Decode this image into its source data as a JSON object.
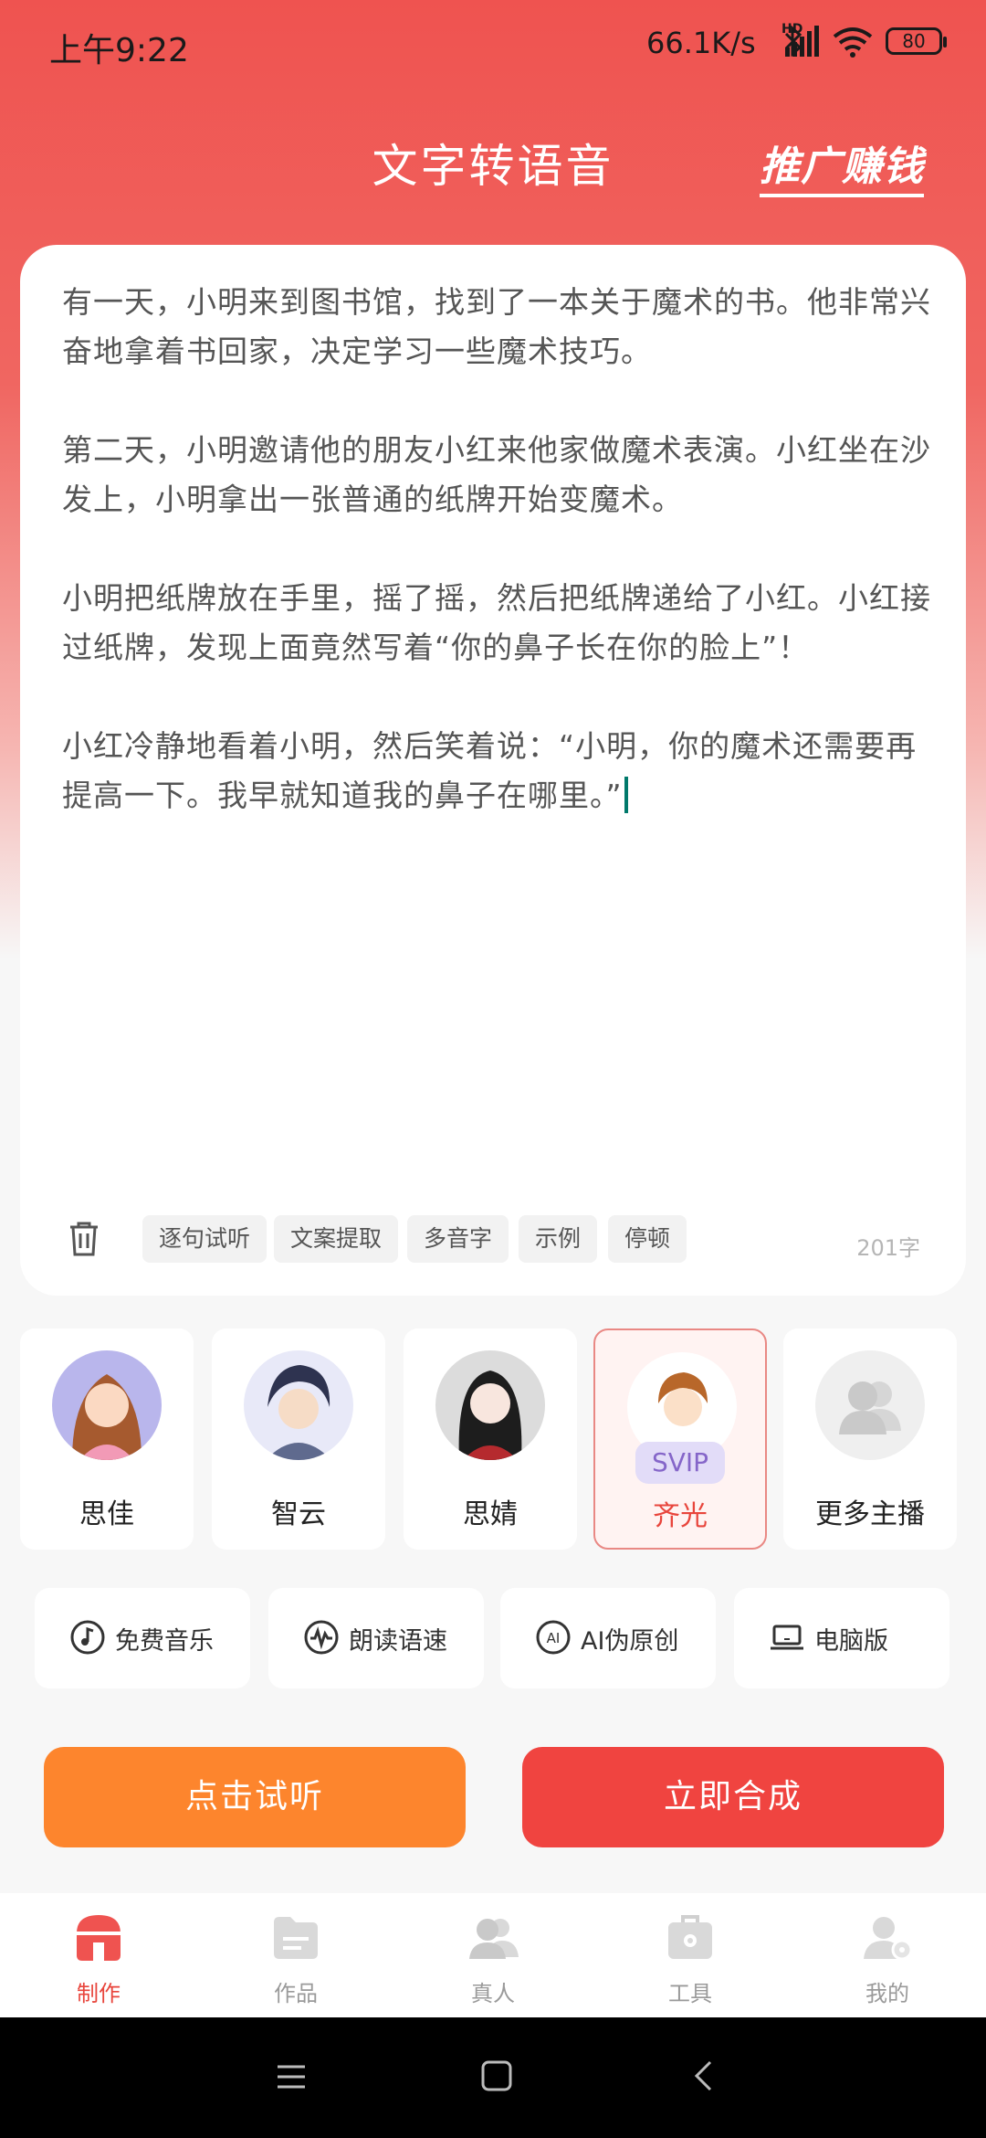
{
  "status_bar": {
    "time": "上午9:22",
    "net_speed": "66.1K/s",
    "hd_label": "HD",
    "battery": "80"
  },
  "header": {
    "title": "文字转语音",
    "promo": "推广赚钱"
  },
  "editor": {
    "paragraphs": [
      "有一天，小明来到图书馆，找到了一本关于魔术的书。他非常兴奋地拿着书回家，决定学习一些魔术技巧。",
      "第二天，小明邀请他的朋友小红来他家做魔术表演。小红坐在沙发上，小明拿出一张普通的纸牌开始变魔术。",
      "小明把纸牌放在手里，摇了摇，然后把纸牌递给了小红。小红接过纸牌，发现上面竟然写着“你的鼻子长在你的脸上”！",
      "小红冷静地看着小明，然后笑着说：“小明，你的魔术还需要再提高一下。我早就知道我的鼻子在哪里。”"
    ],
    "chips": [
      "逐句试听",
      "文案提取",
      "多音字",
      "示例",
      "停顿"
    ],
    "char_count": "201字"
  },
  "voices": [
    {
      "name": "思佳"
    },
    {
      "name": "智云"
    },
    {
      "name": "思婧"
    },
    {
      "name": "齐光",
      "badge": "SVIP"
    },
    {
      "name": "更多主播"
    }
  ],
  "tools": [
    {
      "label": "免费音乐",
      "icon": "music-note-icon"
    },
    {
      "label": "朗读语速",
      "icon": "waveform-icon"
    },
    {
      "label": "AI伪原创",
      "icon": "ai-icon"
    },
    {
      "label": "电脑版",
      "icon": "laptop-icon"
    }
  ],
  "actions": {
    "preview_label": "点击试听",
    "preview_color": "#fd852d",
    "synthesize_label": "立即合成",
    "synthesize_color": "#f04440"
  },
  "bottom_nav": [
    {
      "label": "制作",
      "active": true
    },
    {
      "label": "作品"
    },
    {
      "label": "真人"
    },
    {
      "label": "工具"
    },
    {
      "label": "我的"
    }
  ],
  "theme": {
    "primary": "#ef5350",
    "selected_text": "#e8453c"
  }
}
